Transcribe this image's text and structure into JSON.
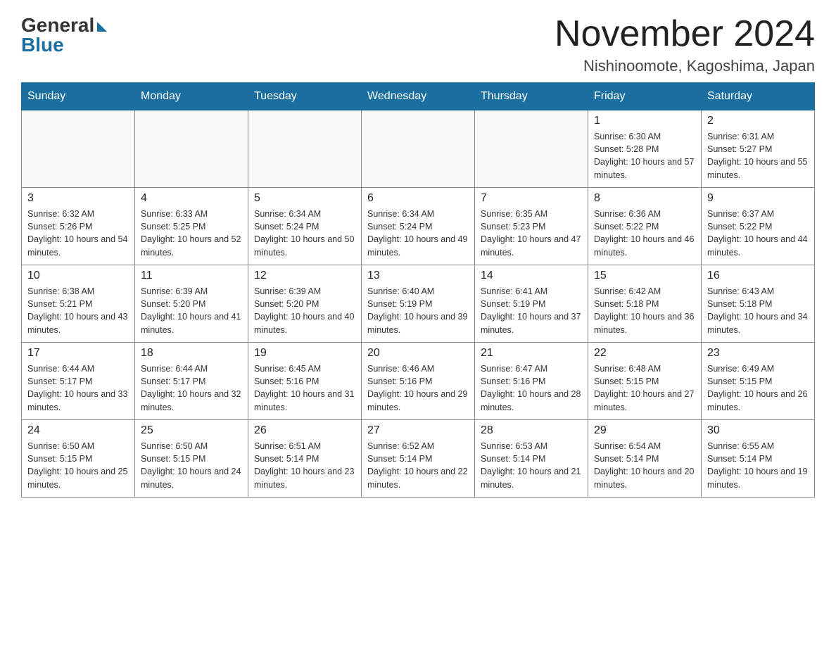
{
  "header": {
    "logo_general": "General",
    "logo_blue": "Blue",
    "month_title": "November 2024",
    "location": "Nishinoomote, Kagoshima, Japan"
  },
  "days_of_week": [
    "Sunday",
    "Monday",
    "Tuesday",
    "Wednesday",
    "Thursday",
    "Friday",
    "Saturday"
  ],
  "weeks": [
    [
      {
        "day": "",
        "info": ""
      },
      {
        "day": "",
        "info": ""
      },
      {
        "day": "",
        "info": ""
      },
      {
        "day": "",
        "info": ""
      },
      {
        "day": "",
        "info": ""
      },
      {
        "day": "1",
        "info": "Sunrise: 6:30 AM\nSunset: 5:28 PM\nDaylight: 10 hours and 57 minutes."
      },
      {
        "day": "2",
        "info": "Sunrise: 6:31 AM\nSunset: 5:27 PM\nDaylight: 10 hours and 55 minutes."
      }
    ],
    [
      {
        "day": "3",
        "info": "Sunrise: 6:32 AM\nSunset: 5:26 PM\nDaylight: 10 hours and 54 minutes."
      },
      {
        "day": "4",
        "info": "Sunrise: 6:33 AM\nSunset: 5:25 PM\nDaylight: 10 hours and 52 minutes."
      },
      {
        "day": "5",
        "info": "Sunrise: 6:34 AM\nSunset: 5:24 PM\nDaylight: 10 hours and 50 minutes."
      },
      {
        "day": "6",
        "info": "Sunrise: 6:34 AM\nSunset: 5:24 PM\nDaylight: 10 hours and 49 minutes."
      },
      {
        "day": "7",
        "info": "Sunrise: 6:35 AM\nSunset: 5:23 PM\nDaylight: 10 hours and 47 minutes."
      },
      {
        "day": "8",
        "info": "Sunrise: 6:36 AM\nSunset: 5:22 PM\nDaylight: 10 hours and 46 minutes."
      },
      {
        "day": "9",
        "info": "Sunrise: 6:37 AM\nSunset: 5:22 PM\nDaylight: 10 hours and 44 minutes."
      }
    ],
    [
      {
        "day": "10",
        "info": "Sunrise: 6:38 AM\nSunset: 5:21 PM\nDaylight: 10 hours and 43 minutes."
      },
      {
        "day": "11",
        "info": "Sunrise: 6:39 AM\nSunset: 5:20 PM\nDaylight: 10 hours and 41 minutes."
      },
      {
        "day": "12",
        "info": "Sunrise: 6:39 AM\nSunset: 5:20 PM\nDaylight: 10 hours and 40 minutes."
      },
      {
        "day": "13",
        "info": "Sunrise: 6:40 AM\nSunset: 5:19 PM\nDaylight: 10 hours and 39 minutes."
      },
      {
        "day": "14",
        "info": "Sunrise: 6:41 AM\nSunset: 5:19 PM\nDaylight: 10 hours and 37 minutes."
      },
      {
        "day": "15",
        "info": "Sunrise: 6:42 AM\nSunset: 5:18 PM\nDaylight: 10 hours and 36 minutes."
      },
      {
        "day": "16",
        "info": "Sunrise: 6:43 AM\nSunset: 5:18 PM\nDaylight: 10 hours and 34 minutes."
      }
    ],
    [
      {
        "day": "17",
        "info": "Sunrise: 6:44 AM\nSunset: 5:17 PM\nDaylight: 10 hours and 33 minutes."
      },
      {
        "day": "18",
        "info": "Sunrise: 6:44 AM\nSunset: 5:17 PM\nDaylight: 10 hours and 32 minutes."
      },
      {
        "day": "19",
        "info": "Sunrise: 6:45 AM\nSunset: 5:16 PM\nDaylight: 10 hours and 31 minutes."
      },
      {
        "day": "20",
        "info": "Sunrise: 6:46 AM\nSunset: 5:16 PM\nDaylight: 10 hours and 29 minutes."
      },
      {
        "day": "21",
        "info": "Sunrise: 6:47 AM\nSunset: 5:16 PM\nDaylight: 10 hours and 28 minutes."
      },
      {
        "day": "22",
        "info": "Sunrise: 6:48 AM\nSunset: 5:15 PM\nDaylight: 10 hours and 27 minutes."
      },
      {
        "day": "23",
        "info": "Sunrise: 6:49 AM\nSunset: 5:15 PM\nDaylight: 10 hours and 26 minutes."
      }
    ],
    [
      {
        "day": "24",
        "info": "Sunrise: 6:50 AM\nSunset: 5:15 PM\nDaylight: 10 hours and 25 minutes."
      },
      {
        "day": "25",
        "info": "Sunrise: 6:50 AM\nSunset: 5:15 PM\nDaylight: 10 hours and 24 minutes."
      },
      {
        "day": "26",
        "info": "Sunrise: 6:51 AM\nSunset: 5:14 PM\nDaylight: 10 hours and 23 minutes."
      },
      {
        "day": "27",
        "info": "Sunrise: 6:52 AM\nSunset: 5:14 PM\nDaylight: 10 hours and 22 minutes."
      },
      {
        "day": "28",
        "info": "Sunrise: 6:53 AM\nSunset: 5:14 PM\nDaylight: 10 hours and 21 minutes."
      },
      {
        "day": "29",
        "info": "Sunrise: 6:54 AM\nSunset: 5:14 PM\nDaylight: 10 hours and 20 minutes."
      },
      {
        "day": "30",
        "info": "Sunrise: 6:55 AM\nSunset: 5:14 PM\nDaylight: 10 hours and 19 minutes."
      }
    ]
  ]
}
